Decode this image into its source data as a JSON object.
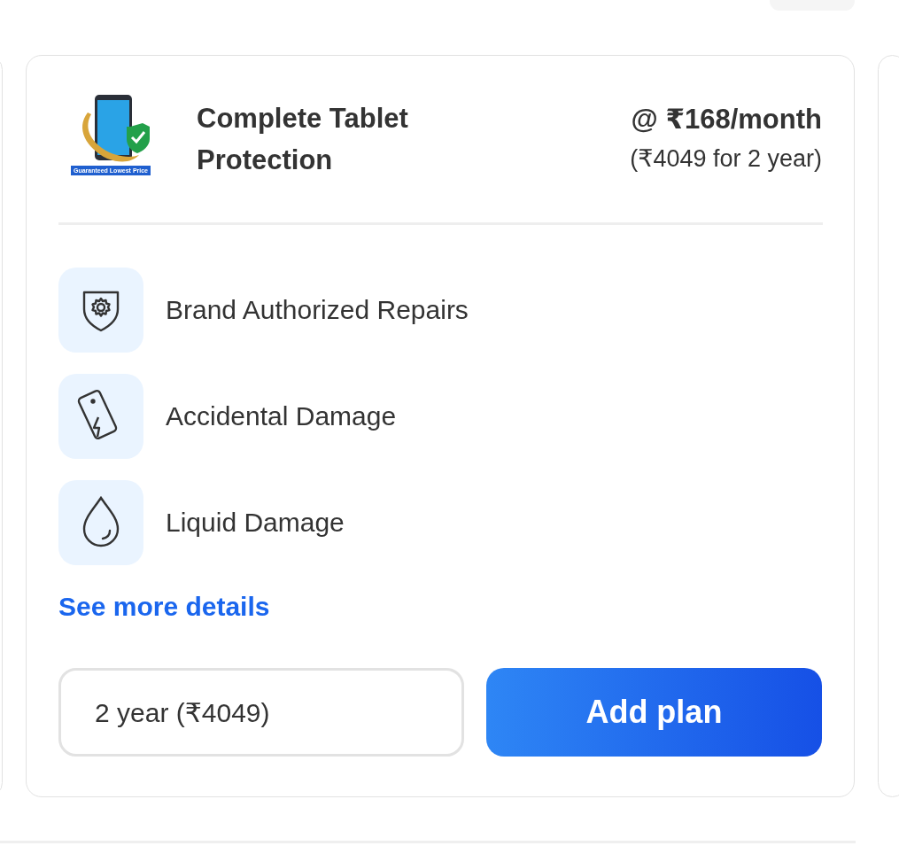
{
  "plan": {
    "badge": "Guaranteed Lowest Price",
    "title": "Complete Tablet Protection",
    "price": "@ ₹168/month",
    "total": "(₹4049 for 2 year)",
    "features": [
      {
        "kind": "repairs",
        "label": "Brand Authorized Repairs"
      },
      {
        "kind": "accidental",
        "label": "Accidental Damage"
      },
      {
        "kind": "liquid",
        "label": "Liquid Damage"
      }
    ],
    "details_link": "See more details",
    "duration": {
      "value": "2 year (₹4049)"
    },
    "add_button": "Add plan"
  }
}
